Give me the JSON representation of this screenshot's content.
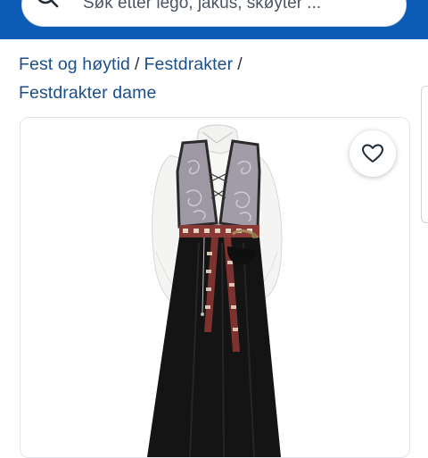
{
  "search": {
    "placeholder": "Søk etter lego, jakus, skøyter ...",
    "icon": "search-icon"
  },
  "breadcrumb": {
    "items": [
      "Fest og høytid",
      "Festdrakter",
      "Festdrakter dame"
    ],
    "separator": "/"
  },
  "listing": {
    "image_subject": "bunad-dress",
    "favorite_icon": "heart-icon"
  },
  "colors": {
    "brand_blue": "#0c5bb5",
    "link_blue": "#1a4f8c"
  }
}
